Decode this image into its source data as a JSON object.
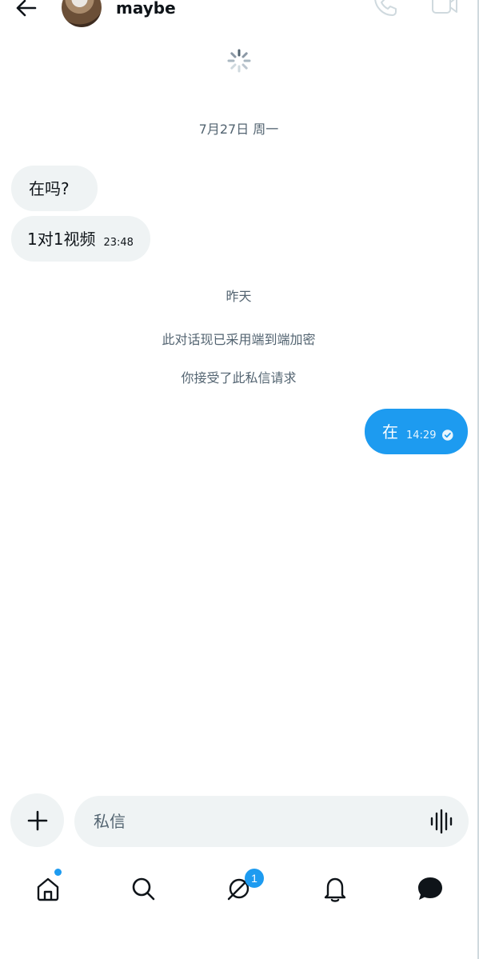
{
  "header": {
    "contact_name": "maybe",
    "icons": {
      "back": "back-arrow-icon",
      "call": "phone-icon",
      "video": "video-camera-icon"
    }
  },
  "conversation": {
    "loading": true,
    "date_separator": "7月27日 周一",
    "messages_day1": [
      {
        "direction": "in",
        "text": "在吗?",
        "time": ""
      },
      {
        "direction": "in",
        "text": "1对1视频",
        "time": "23:48"
      }
    ],
    "yesterday_label": "昨天",
    "encryption_notice": "此对话现已采用端到端加密",
    "request_notice": "你接受了此私信请求",
    "messages_day2": [
      {
        "direction": "out",
        "text": "在",
        "time": "14:29",
        "status": "read"
      }
    ]
  },
  "composer": {
    "placeholder": "私信",
    "value": "",
    "icons": {
      "add": "plus-icon",
      "voice": "voice-waveform-icon"
    }
  },
  "bottom_nav": {
    "items": [
      {
        "name": "home",
        "icon": "home-icon",
        "has_dot": true
      },
      {
        "name": "search",
        "icon": "search-icon"
      },
      {
        "name": "spaces",
        "icon": "spaces-icon",
        "badge": "1"
      },
      {
        "name": "notifications",
        "icon": "bell-icon"
      },
      {
        "name": "messages",
        "icon": "message-icon",
        "active": true
      }
    ]
  },
  "colors": {
    "accent": "#1d9bf0",
    "bubble_in": "#eff3f4",
    "text_primary": "#0f1419",
    "text_secondary": "#536471"
  }
}
